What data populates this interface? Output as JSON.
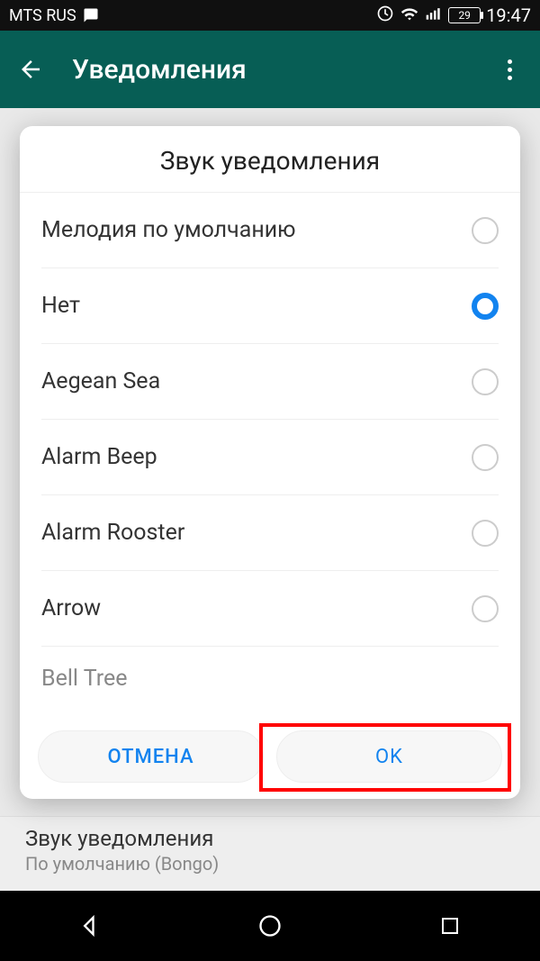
{
  "status": {
    "carrier": "MTS RUS",
    "battery": "29",
    "time": "19:47"
  },
  "appbar": {
    "title": "Уведомления"
  },
  "dialog": {
    "title": "Звук уведомления",
    "options": [
      {
        "label": "Мелодия по умолчанию",
        "selected": false
      },
      {
        "label": "Нет",
        "selected": true
      },
      {
        "label": "Aegean Sea",
        "selected": false
      },
      {
        "label": "Alarm Beep",
        "selected": false
      },
      {
        "label": "Alarm Rooster",
        "selected": false
      },
      {
        "label": "Arrow",
        "selected": false
      },
      {
        "label": "Bell Tree",
        "selected": false
      }
    ],
    "cancel": "ОТМЕНА",
    "ok": "OK"
  },
  "bg": {
    "title": "Звук уведомления",
    "subtitle": "По умолчанию (Bongo)"
  }
}
